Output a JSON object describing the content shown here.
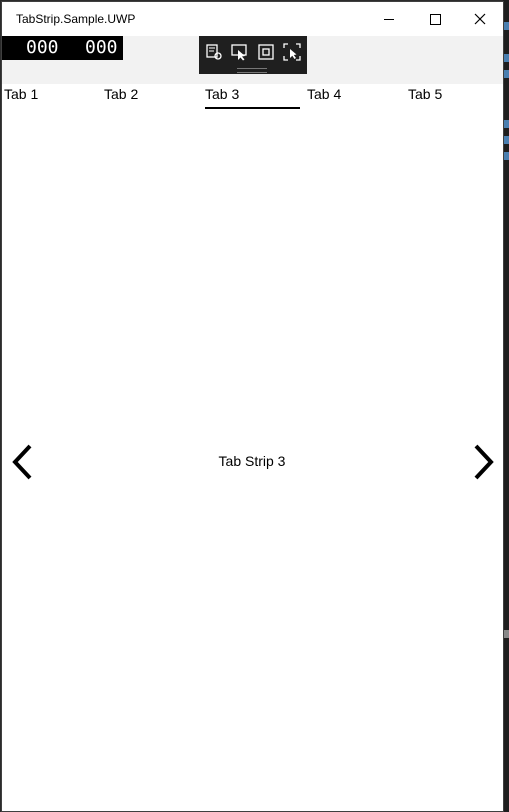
{
  "window": {
    "title": "TabStrip.Sample.UWP"
  },
  "fps_counter": {
    "left": "000",
    "right": "000"
  },
  "debug_toolbar": {
    "icons": [
      "live-visual-tree-icon",
      "select-element-icon",
      "display-layout-adorners-icon",
      "track-focus-icon"
    ]
  },
  "tabs": [
    {
      "label": "Tab 1",
      "selected": false
    },
    {
      "label": "Tab 2",
      "selected": false
    },
    {
      "label": "Tab 3",
      "selected": true
    },
    {
      "label": "Tab 4",
      "selected": false
    },
    {
      "label": "Tab 5",
      "selected": false
    }
  ],
  "content": {
    "label": "Tab Strip 3"
  },
  "colors": {
    "window_bg": "#ffffff",
    "toolbar_band": "#f2f2f2",
    "indicator": "#000000",
    "debug_toolbar_bg": "#1f1f1f"
  }
}
